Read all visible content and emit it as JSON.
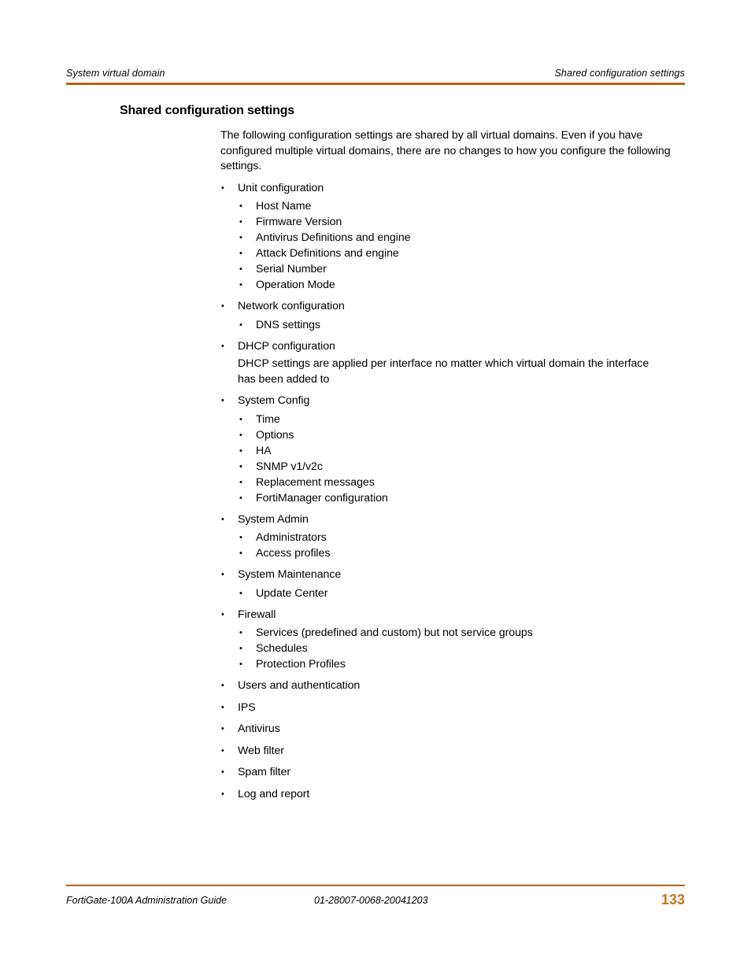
{
  "header": {
    "left": "System virtual domain",
    "right": "Shared configuration settings"
  },
  "section": {
    "title": "Shared configuration settings",
    "intro": "The following configuration settings are shared by all virtual domains. Even if you have configured multiple virtual domains, there are no changes to how you configure the following settings."
  },
  "bullets": [
    {
      "label": "Unit configuration",
      "children": [
        "Host Name",
        "Firmware Version",
        "Antivirus Definitions and engine",
        "Attack Definitions and engine",
        "Serial Number",
        "Operation Mode"
      ]
    },
    {
      "label": "Network configuration",
      "children": [
        "DNS settings"
      ]
    },
    {
      "label": "DHCP configuration",
      "note": "DHCP settings are applied per interface no matter which virtual domain the interface has been added to",
      "children": []
    },
    {
      "label": "System Config",
      "children": [
        "Time",
        "Options",
        "HA",
        "SNMP v1/v2c",
        "Replacement messages",
        "FortiManager configuration"
      ]
    },
    {
      "label": "System Admin",
      "children": [
        "Administrators",
        "Access profiles"
      ]
    },
    {
      "label": "System Maintenance",
      "children": [
        "Update Center"
      ]
    },
    {
      "label": "Firewall",
      "children": [
        "Services (predefined and custom) but not service groups",
        "Schedules",
        "Protection Profiles"
      ]
    },
    {
      "label": "Users and authentication",
      "children": []
    },
    {
      "label": "IPS",
      "children": []
    },
    {
      "label": "Antivirus",
      "children": []
    },
    {
      "label": "Web filter",
      "children": []
    },
    {
      "label": "Spam filter",
      "children": []
    },
    {
      "label": "Log and report",
      "children": []
    }
  ],
  "footer": {
    "guide": "FortiGate-100A Administration Guide",
    "doc_number": "01-28007-0068-20041203",
    "page_number": "133"
  },
  "colors": {
    "rule": "#B76209",
    "page_number": "#C87518"
  }
}
